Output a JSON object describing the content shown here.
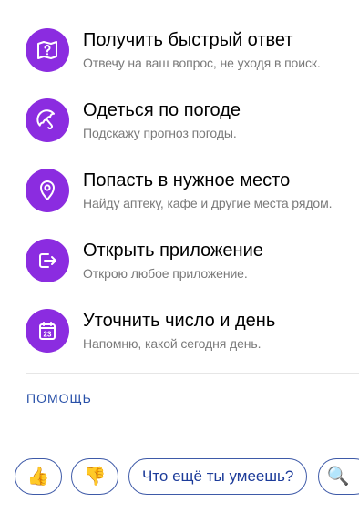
{
  "skills": [
    {
      "icon": "map-question-icon",
      "title": "Получить быстрый ответ",
      "subtitle": "Отвечу на ваш вопрос, не уходя в поиск."
    },
    {
      "icon": "umbrella-icon",
      "title": "Одеться по погоде",
      "subtitle": "Подскажу прогноз погоды."
    },
    {
      "icon": "location-pin-icon",
      "title": "Попасть в нужное место",
      "subtitle": "Найду аптеку, кафе и другие места рядом."
    },
    {
      "icon": "open-app-icon",
      "title": "Открыть приложение",
      "subtitle": "Открою любое приложение."
    },
    {
      "icon": "calendar-icon",
      "title": "Уточнить число и день",
      "subtitle": "Напомню, какой сегодня день.",
      "calendar_number": "23"
    }
  ],
  "help_link": "ПОМОЩЬ",
  "bottom_bar": {
    "thumbs_up": "👍",
    "thumbs_down": "👎",
    "suggestion": "Что ещё ты умеешь?",
    "search_glyph": "🔍"
  },
  "colors": {
    "icon_bg": "#8b2ce0",
    "link": "#2850a8",
    "button_border": "#3e5aa8"
  }
}
